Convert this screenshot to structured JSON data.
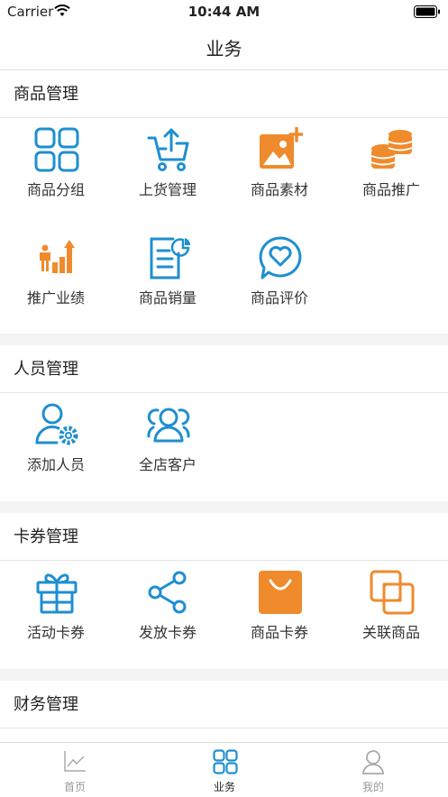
{
  "status_bar": {
    "carrier": "Carrier",
    "time": "10:44 AM"
  },
  "header": {
    "title": "业务"
  },
  "colors": {
    "blue": "#1e8fd0",
    "orange": "#ef8b2c"
  },
  "sections": [
    {
      "title": "商品管理",
      "items": [
        {
          "label": "商品分组",
          "icon": "grid-icon"
        },
        {
          "label": "上货管理",
          "icon": "cart-upload-icon"
        },
        {
          "label": "商品素材",
          "icon": "image-add-icon"
        },
        {
          "label": "商品推广",
          "icon": "coins-icon"
        },
        {
          "label": "推广业绩",
          "icon": "bar-chart-icon"
        },
        {
          "label": "商品销量",
          "icon": "sales-report-icon"
        },
        {
          "label": "商品评价",
          "icon": "heart-chat-icon"
        }
      ]
    },
    {
      "title": "人员管理",
      "items": [
        {
          "label": "添加人员",
          "icon": "user-settings-icon"
        },
        {
          "label": "全店客户",
          "icon": "users-group-icon"
        }
      ]
    },
    {
      "title": "卡券管理",
      "items": [
        {
          "label": "活动卡券",
          "icon": "gift-icon"
        },
        {
          "label": "发放卡券",
          "icon": "share-icon"
        },
        {
          "label": "商品卡券",
          "icon": "shopping-bag-icon"
        },
        {
          "label": "关联商品",
          "icon": "linked-squares-icon"
        }
      ]
    },
    {
      "title": "财务管理",
      "items": []
    }
  ],
  "tabbar": {
    "items": [
      {
        "label": "首页",
        "icon": "trend-chart-icon",
        "active": false
      },
      {
        "label": "业务",
        "icon": "grid-icon",
        "active": true
      },
      {
        "label": "我的",
        "icon": "person-icon",
        "active": false
      }
    ]
  }
}
